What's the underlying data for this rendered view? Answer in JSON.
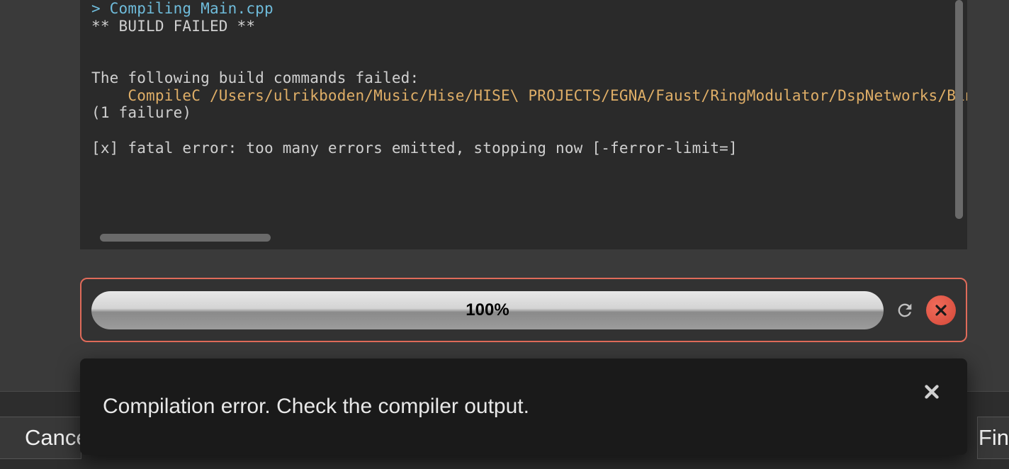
{
  "terminal": {
    "lines": [
      {
        "cls": "term-cyan",
        "text": "> Compiling Main.cpp"
      },
      {
        "cls": "term-white",
        "text": "** BUILD FAILED **"
      },
      {
        "cls": "term-white",
        "text": ""
      },
      {
        "cls": "term-white",
        "text": ""
      },
      {
        "cls": "term-white",
        "text": "The following build commands failed:"
      },
      {
        "cls": "term-yellow",
        "text": "    CompileC /Users/ulrikboden/Music/Hise/HISE\\ PROJECTS/EGNA/Faust/RingModulator/DspNetworks/Bina"
      },
      {
        "cls": "term-white",
        "text": "(1 failure)"
      },
      {
        "cls": "term-white",
        "text": ""
      },
      {
        "cls": "term-white",
        "text": "[x] fatal error: too many errors emitted, stopping now [-ferror-limit=]"
      }
    ]
  },
  "progress": {
    "percent_label": "100%"
  },
  "toast": {
    "message": "Compilation error. Check the compiler output."
  },
  "buttons": {
    "cancel": "Cance",
    "finish": "Fin"
  },
  "colors": {
    "error_border": "#e06b5a",
    "terminal_bg": "#2a2a2a",
    "toast_bg": "#1a1a1a"
  }
}
